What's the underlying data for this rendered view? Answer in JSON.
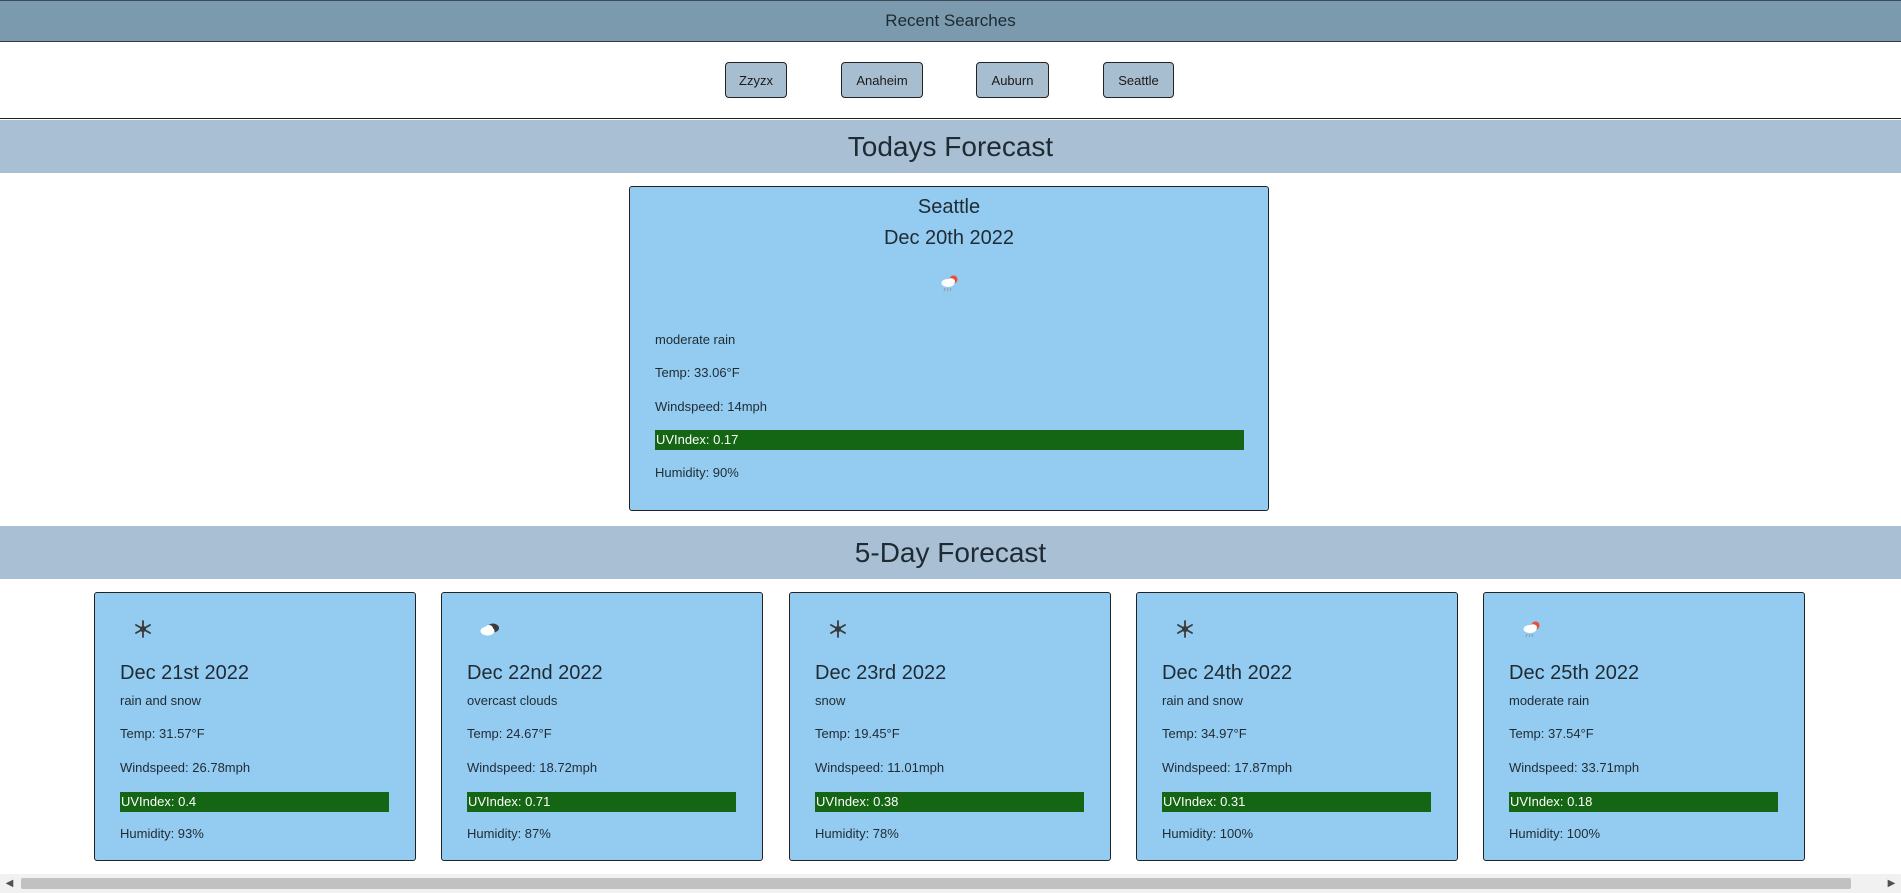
{
  "recent": {
    "title": "Recent Searches",
    "buttons": [
      "Zzyzx",
      "Anaheim",
      "Auburn",
      "Seattle"
    ]
  },
  "today": {
    "section_title": "Todays Forecast",
    "city": "Seattle",
    "date": "Dec 20th 2022",
    "icon": "rain-cloud-icon",
    "description": "moderate rain",
    "temp": "Temp: 33.06°F",
    "wind": "Windspeed: 14mph",
    "uv": "UVIndex: 0.17",
    "humidity": "Humidity: 90%"
  },
  "forecast": {
    "section_title": "5-Day Forecast",
    "days": [
      {
        "date": "Dec 21st 2022",
        "icon": "snowflake-icon",
        "description": "rain and snow",
        "temp": "Temp: 31.57°F",
        "wind": "Windspeed: 26.78mph",
        "uv": "UVIndex: 0.4",
        "humidity": "Humidity: 93%"
      },
      {
        "date": "Dec 22nd 2022",
        "icon": "overcast-clouds-icon",
        "description": "overcast clouds",
        "temp": "Temp: 24.67°F",
        "wind": "Windspeed: 18.72mph",
        "uv": "UVIndex: 0.71",
        "humidity": "Humidity: 87%"
      },
      {
        "date": "Dec 23rd 2022",
        "icon": "snowflake-icon",
        "description": "snow",
        "temp": "Temp: 19.45°F",
        "wind": "Windspeed: 11.01mph",
        "uv": "UVIndex: 0.38",
        "humidity": "Humidity: 78%"
      },
      {
        "date": "Dec 24th 2022",
        "icon": "snowflake-icon",
        "description": "rain and snow",
        "temp": "Temp: 34.97°F",
        "wind": "Windspeed: 17.87mph",
        "uv": "UVIndex: 0.31",
        "humidity": "Humidity: 100%"
      },
      {
        "date": "Dec 25th 2022",
        "icon": "rain-cloud-icon",
        "description": "moderate rain",
        "temp": "Temp: 37.54°F",
        "wind": "Windspeed: 33.71mph",
        "uv": "UVIndex: 0.18",
        "humidity": "Humidity: 100%"
      }
    ]
  },
  "colors": {
    "header_bar": "#7b9aae",
    "section_band": "#a9bfd4",
    "card_bg": "#94cbf0",
    "uv_bar": "#146514",
    "button_bg": "#a7bed0"
  }
}
